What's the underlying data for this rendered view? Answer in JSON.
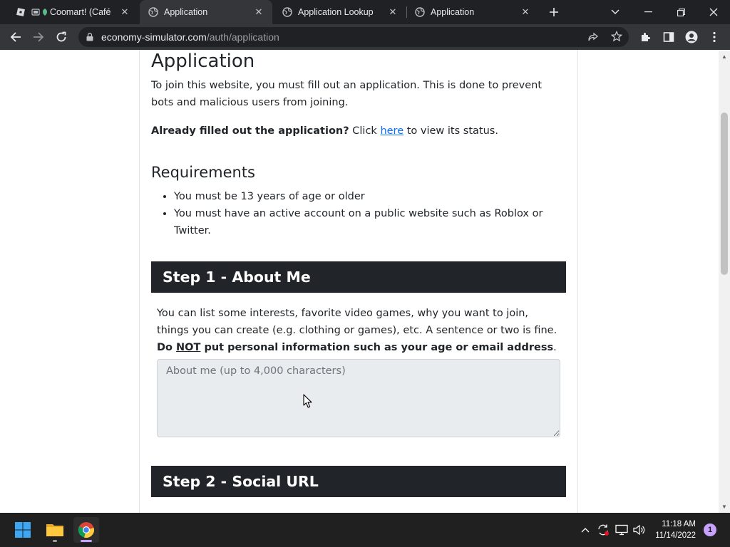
{
  "browser": {
    "tabs": [
      {
        "title": "Coomart! (Café",
        "active": false
      },
      {
        "title": "Application",
        "active": true
      },
      {
        "title": "Application Lookup",
        "active": false
      },
      {
        "title": "Application",
        "active": false
      }
    ],
    "new_tab_icon": "plus-icon",
    "url_host": "economy-simulator.com",
    "url_path": "/auth/application"
  },
  "page": {
    "title": "Application",
    "intro": "To join this website, you must fill out an application. This is done to prevent bots and malicious users from joining.",
    "status_bold": "Already filled out the application?",
    "status_pre": " Click ",
    "status_link": "here",
    "status_post": " to view its status.",
    "requirements_title": "Requirements",
    "requirements": [
      "You must be 13 years of age or older",
      "You must have an active account on a public website such as Roblox or Twitter."
    ],
    "step1": {
      "title": "Step 1 - About Me",
      "desc_text": "You can list some interests, favorite video games, why you want to join, things you can create (e.g. clothing or games), etc. A sentence or two is fine. ",
      "desc_bold_pre": "Do ",
      "desc_bold_underline": "NOT",
      "desc_bold_post": " put personal information such as your age or email address",
      "desc_end": ".",
      "placeholder": "About me (up to 4,000 characters)",
      "value": ""
    },
    "step2": {
      "title": "Step 2 - Social URL"
    }
  },
  "taskbar": {
    "time": "11:18 AM",
    "date": "11/14/2022",
    "notification_count": "1"
  },
  "colors": {
    "step_header_bg": "#212529",
    "link": "#0d6efd",
    "textarea_bg": "#e9ecef"
  }
}
